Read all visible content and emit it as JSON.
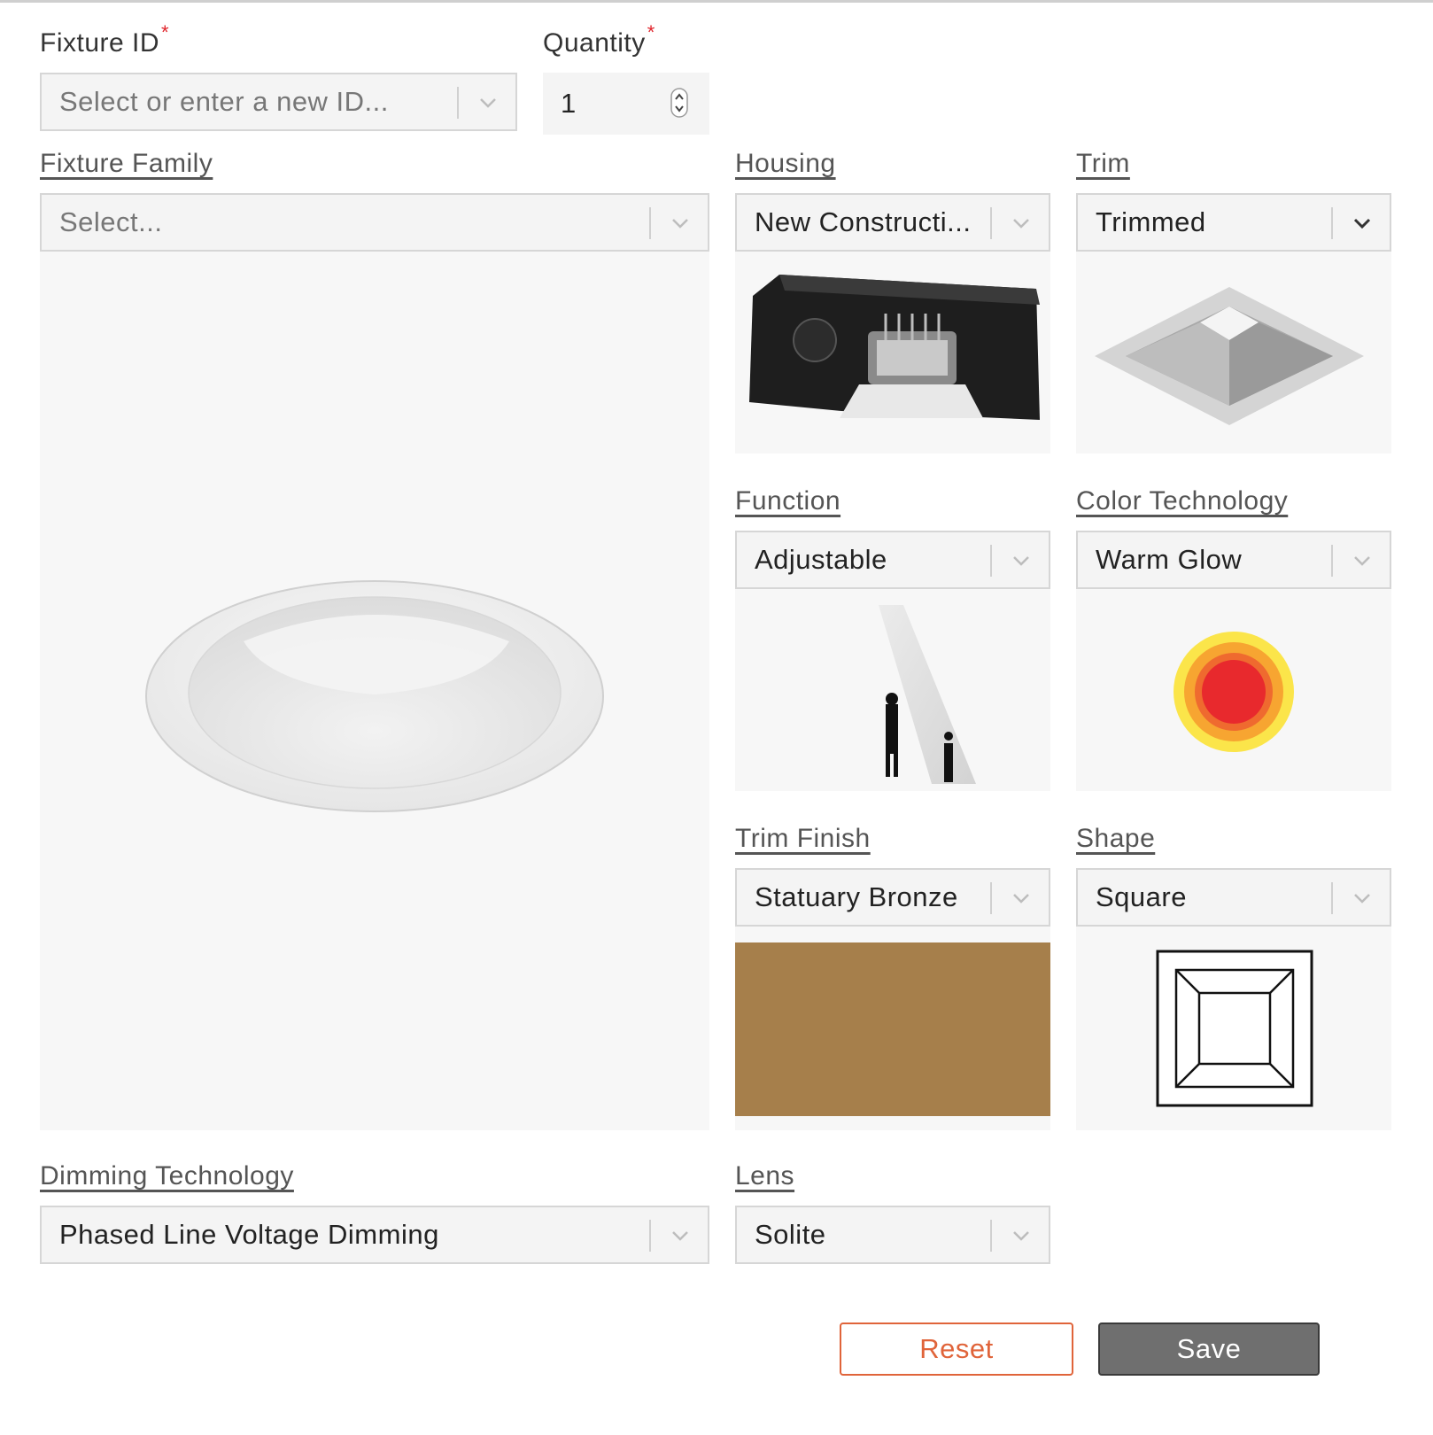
{
  "form": {
    "fixture_id": {
      "label": "Fixture ID",
      "required_mark": "*",
      "placeholder": "Select or enter a new ID..."
    },
    "quantity": {
      "label": "Quantity",
      "required_mark": "*",
      "value": "1"
    },
    "fixture_family": {
      "label": "Fixture Family",
      "placeholder": "Select..."
    },
    "housing": {
      "label": "Housing",
      "value": "New Constructi..."
    },
    "trim": {
      "label": "Trim",
      "value": "Trimmed"
    },
    "function": {
      "label": "Function",
      "value": "Adjustable"
    },
    "color_technology": {
      "label": "Color Technology",
      "value": "Warm Glow"
    },
    "trim_finish": {
      "label": "Trim Finish",
      "value": "Statuary Bronze",
      "swatch_color": "#a67f4b"
    },
    "shape": {
      "label": "Shape",
      "value": "Square"
    },
    "dimming_technology": {
      "label": "Dimming Technology",
      "value": "Phased Line Voltage Dimming"
    },
    "lens": {
      "label": "Lens",
      "value": "Solite"
    }
  },
  "buttons": {
    "reset": "Reset",
    "save": "Save"
  },
  "colors": {
    "reset_accent": "#e0643a",
    "save_bg": "#6f6f6f",
    "required": "#e0242b",
    "warm_glow": [
      "#fbe54a",
      "#f7a531",
      "#e8292d"
    ]
  },
  "icons": [
    "chevron-down-icon",
    "spinner-icon",
    "downlight-image",
    "housing-image",
    "trim-image",
    "function-image",
    "warm-glow-icon",
    "square-shape-icon"
  ]
}
